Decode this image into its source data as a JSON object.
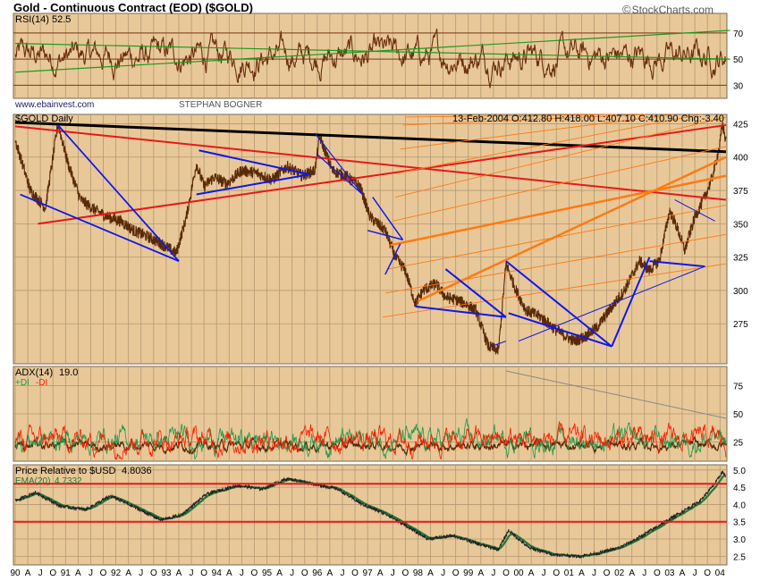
{
  "header": {
    "title": "Gold - Continuous Contract (EOD) ($GOLD)",
    "copyright_symbol": "©",
    "copyright": "StockCharts.com"
  },
  "colors": {
    "background": "#e8c898",
    "grid": "#b49872",
    "price": "#5a2a08",
    "rsi_line": "#6b3010",
    "adx_line": "#5a2a0a",
    "plus_di": "#1c9a4c",
    "minus_di": "#ff1a00",
    "ema": "#1f7a3c",
    "trend_black": "#000000",
    "trend_red": "#e81818",
    "trend_blue": "#1018e8",
    "fan_orange": "#ff7a14"
  },
  "chart_data": [
    {
      "panel": "rsi",
      "type": "line",
      "label": "RSI(14)",
      "value_label": "52.5",
      "y_ticks": [
        30,
        50,
        70
      ],
      "ylim": [
        20,
        85
      ],
      "levels": [
        30,
        50,
        70
      ],
      "watermark_1": "www.ebainvest.com",
      "watermark_2": "STEPHAN BOGNER",
      "trendlines": [
        {
          "from": [
            1990.0,
            40
          ],
          "to": [
            2004.2,
            72
          ]
        },
        {
          "from": [
            1990.0,
            62
          ],
          "to": [
            2004.2,
            50
          ]
        }
      ]
    },
    {
      "panel": "price",
      "type": "line",
      "label": "$GOLD Daily",
      "quote_date": "13-Feb-2004",
      "quote": "O:412.80 H:418.00 L:407.10 C:410.90 Chg:-3.40",
      "y_ticks": [
        275,
        300,
        325,
        350,
        375,
        400,
        425
      ],
      "ylim": [
        245,
        432
      ],
      "key_points": [
        [
          1990.0,
          413
        ],
        [
          1990.3,
          375
        ],
        [
          1990.6,
          362
        ],
        [
          1990.85,
          425
        ],
        [
          1991.05,
          395
        ],
        [
          1991.3,
          368
        ],
        [
          1991.6,
          360
        ],
        [
          1991.85,
          355
        ],
        [
          1992.1,
          352
        ],
        [
          1992.35,
          345
        ],
        [
          1992.65,
          340
        ],
        [
          1992.9,
          335
        ],
        [
          1993.2,
          328
        ],
        [
          1993.4,
          355
        ],
        [
          1993.6,
          395
        ],
        [
          1993.75,
          378
        ],
        [
          1993.95,
          385
        ],
        [
          1994.2,
          380
        ],
        [
          1994.5,
          390
        ],
        [
          1994.8,
          388
        ],
        [
          1995.1,
          383
        ],
        [
          1995.4,
          393
        ],
        [
          1995.7,
          386
        ],
        [
          1995.95,
          390
        ],
        [
          1996.05,
          415
        ],
        [
          1996.3,
          390
        ],
        [
          1996.6,
          385
        ],
        [
          1996.85,
          378
        ],
        [
          1997.05,
          355
        ],
        [
          1997.35,
          345
        ],
        [
          1997.55,
          325
        ],
        [
          1997.75,
          315
        ],
        [
          1997.95,
          290
        ],
        [
          1998.1,
          300
        ],
        [
          1998.35,
          305
        ],
        [
          1998.55,
          295
        ],
        [
          1998.75,
          293
        ],
        [
          1998.95,
          290
        ],
        [
          1999.15,
          285
        ],
        [
          1999.4,
          258
        ],
        [
          1999.6,
          255
        ],
        [
          1999.75,
          320
        ],
        [
          1999.95,
          300
        ],
        [
          2000.15,
          285
        ],
        [
          2000.45,
          280
        ],
        [
          2000.75,
          270
        ],
        [
          2001.1,
          262
        ],
        [
          2001.3,
          265
        ],
        [
          2001.55,
          272
        ],
        [
          2001.8,
          285
        ],
        [
          2002.1,
          300
        ],
        [
          2002.4,
          322
        ],
        [
          2002.6,
          315
        ],
        [
          2002.8,
          323
        ],
        [
          2003.0,
          360
        ],
        [
          2003.15,
          347
        ],
        [
          2003.3,
          330
        ],
        [
          2003.5,
          355
        ],
        [
          2003.7,
          370
        ],
        [
          2003.85,
          385
        ],
        [
          2004.0,
          410
        ],
        [
          2004.05,
          425
        ],
        [
          2004.12,
          411
        ]
      ]
    },
    {
      "panel": "adx",
      "type": "line",
      "label": "ADX(14)",
      "value_label": "19.0",
      "plus_label": "+DI",
      "minus_label": "-DI",
      "y_ticks": [
        25,
        50,
        75
      ],
      "ylim": [
        8,
        92
      ],
      "series": [
        {
          "name": "ADX(14)",
          "mean": 22,
          "spread": 10
        },
        {
          "name": "+DI",
          "mean": 27,
          "spread": 22
        },
        {
          "name": "-DI",
          "mean": 27,
          "spread": 22
        }
      ]
    },
    {
      "panel": "relative",
      "type": "line",
      "label": "Price Relative to $USD",
      "value_label": "4.8036",
      "ema_label": "EMA(20)",
      "ema_value": "4.7332",
      "y_ticks": [
        2.5,
        3.0,
        3.5,
        4.0,
        4.5,
        5.0
      ],
      "ylim": [
        2.25,
        5.15
      ],
      "levels": [
        3.5,
        4.6
      ],
      "key_points": [
        [
          1990.0,
          4.1
        ],
        [
          1990.4,
          4.35
        ],
        [
          1990.9,
          3.95
        ],
        [
          1991.4,
          3.85
        ],
        [
          1991.9,
          4.25
        ],
        [
          1992.4,
          3.9
        ],
        [
          1992.9,
          3.55
        ],
        [
          1993.3,
          3.7
        ],
        [
          1993.8,
          4.3
        ],
        [
          1994.4,
          4.55
        ],
        [
          1994.9,
          4.45
        ],
        [
          1995.4,
          4.75
        ],
        [
          1995.9,
          4.6
        ],
        [
          1996.4,
          4.45
        ],
        [
          1996.9,
          4.0
        ],
        [
          1997.4,
          3.7
        ],
        [
          1997.8,
          3.35
        ],
        [
          1998.2,
          3.0
        ],
        [
          1998.7,
          3.1
        ],
        [
          1999.2,
          2.85
        ],
        [
          1999.6,
          2.7
        ],
        [
          1999.8,
          3.25
        ],
        [
          2000.2,
          2.75
        ],
        [
          2000.7,
          2.55
        ],
        [
          2001.2,
          2.5
        ],
        [
          2001.6,
          2.6
        ],
        [
          2002.0,
          2.75
        ],
        [
          2002.4,
          3.05
        ],
        [
          2002.8,
          3.4
        ],
        [
          2003.2,
          3.75
        ],
        [
          2003.6,
          4.1
        ],
        [
          2003.9,
          4.6
        ],
        [
          2004.05,
          4.95
        ],
        [
          2004.12,
          4.8
        ]
      ]
    }
  ],
  "x_axis": {
    "month_labels": [
      "90",
      "A",
      "J",
      "O",
      "91",
      "A",
      "J",
      "O",
      "92",
      "A",
      "J",
      "O",
      "93",
      "A",
      "J",
      "O",
      "94",
      "A",
      "J",
      "O",
      "95",
      "A",
      "J",
      "O",
      "96",
      "A",
      "J",
      "O",
      "97",
      "A",
      "J",
      "O",
      "98",
      "A",
      "J",
      "O",
      "99",
      "A",
      "J",
      "O",
      "00",
      "A",
      "J",
      "O",
      "01",
      "A",
      "J",
      "O",
      "02",
      "A",
      "J",
      "O",
      "03",
      "A",
      "J",
      "O",
      "04"
    ],
    "start_year": 1990,
    "end_year": 2004.12
  }
}
